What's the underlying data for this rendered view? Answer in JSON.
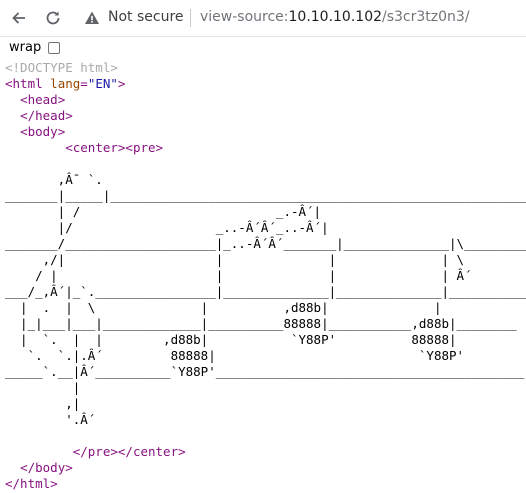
{
  "toolbar": {
    "security_label": "Not secure",
    "url_scheme": "view-source:",
    "url_host": "10.10.10.102",
    "url_path": "/s3cr3tz0n3/",
    "back_icon": "arrow-left-icon",
    "reload_icon": "reload-icon",
    "info_icon": "warning-triangle-icon"
  },
  "wrap": {
    "label": "wrap",
    "checked": false
  },
  "source": {
    "doctype": "<!DOCTYPE html>",
    "html_open_tag": "<html",
    "lang_attr": "lang",
    "lang_value": "\"EN\"",
    "html_open_end": ">",
    "head_open": "<head>",
    "head_close": "</head>",
    "body_open": "<body>",
    "center_pre_open": "<center><pre>",
    "art_lines": [
      "       ,Â¯ `.",
      "_______|_____|________________________________________________________",
      "       | /                          _.-Â´|",
      "       |/                   _..-Â´Â´_..-Â´|",
      "_______/____________________|_..-Â´Â´_______|______________|\\_________",
      "     ,/|                    |              |              | \\",
      "    / |                     |              |              | Â´",
      "___/_,Â´|_`.________________|______________|______________|___________",
      "  |  .  |  \\              |          ,d88b|              |",
      "  |_|___|___|_____________|__________88888|___________,d88b|________",
      "  |  `.  |  |        ,d88b|           `Y88P'          88888|",
      "   `.  `.|.Â´         88888|                           `Y88P'",
      "_____`.__|Â´__________`Y88P'_________________________________________",
      "         |",
      "        ,|",
      "        '.Â´"
    ],
    "pre_center_close": "</pre></center>",
    "body_close": "</body>",
    "html_close": "</html>"
  }
}
